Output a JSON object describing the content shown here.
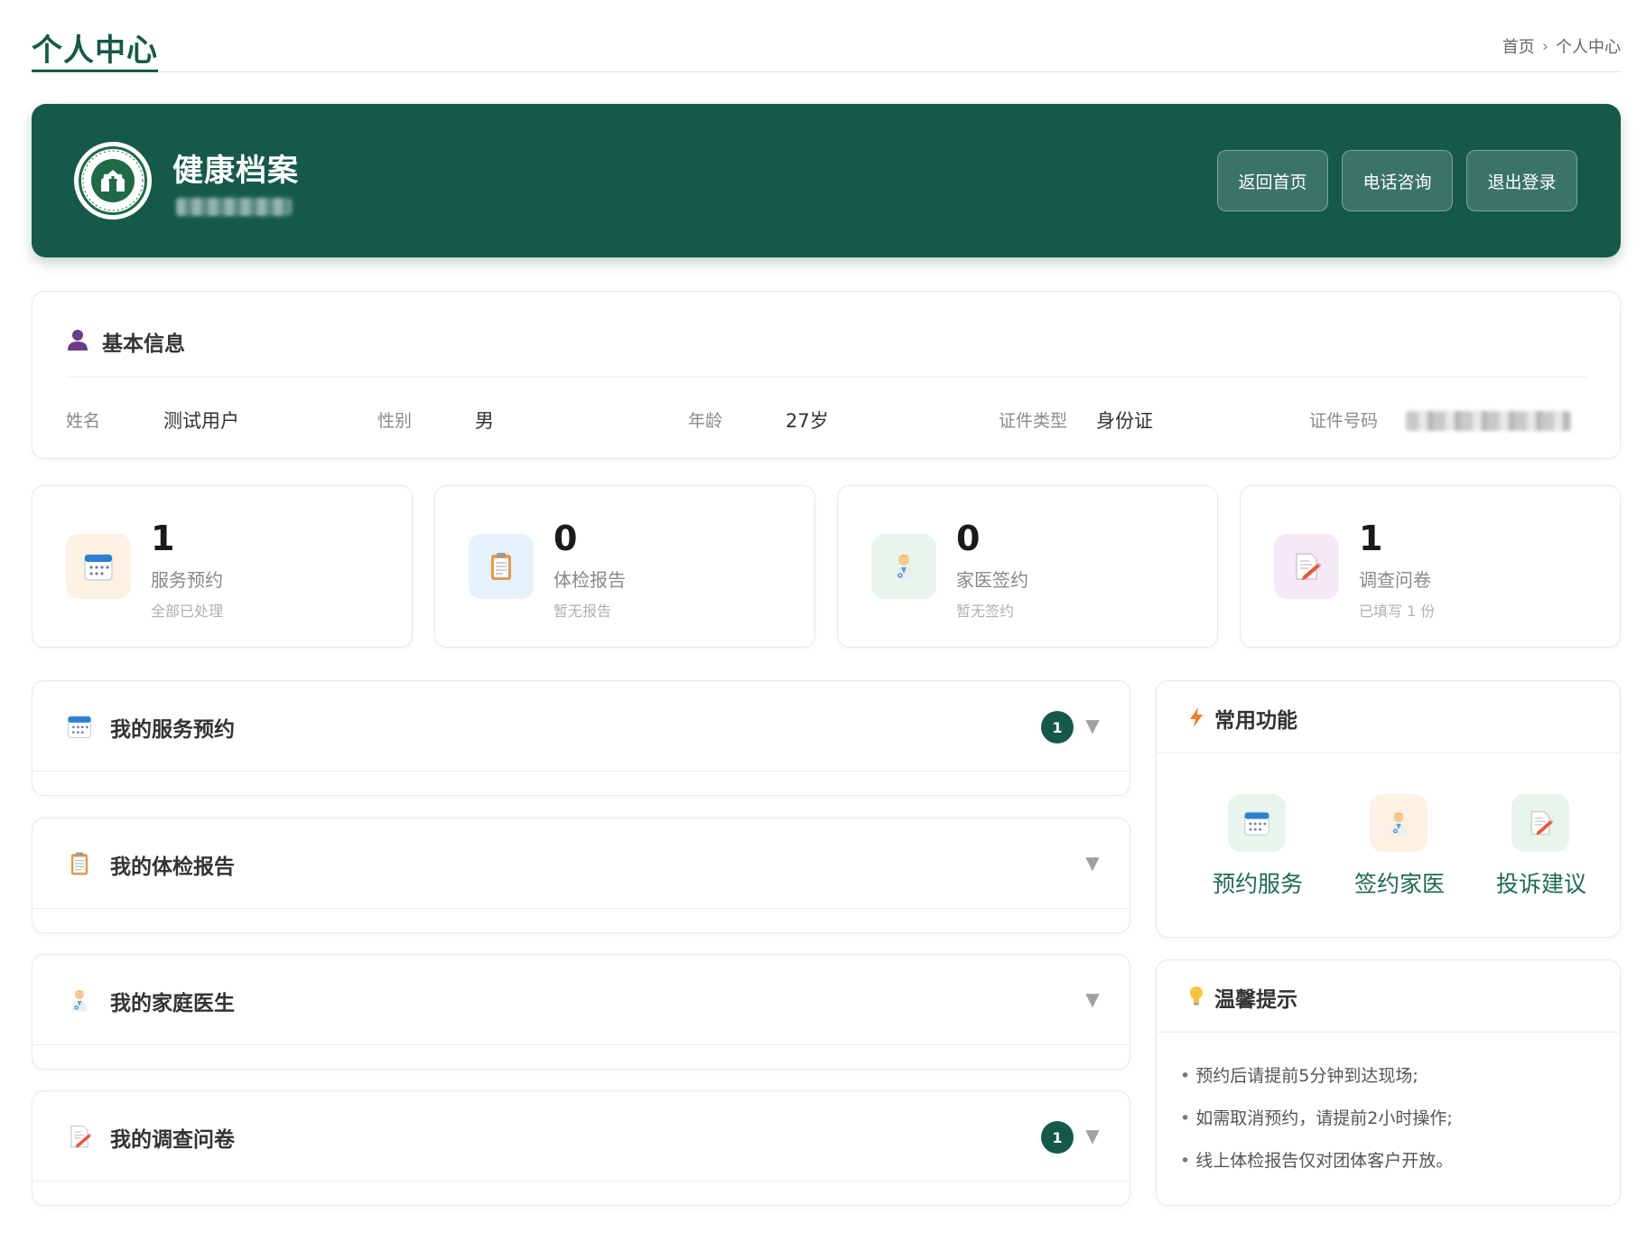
{
  "page": {
    "title": "个人中心",
    "breadcrumb": [
      "首页",
      "个人中心"
    ],
    "breadcrumb_separator": "›"
  },
  "banner": {
    "title": "健康档案",
    "logo_icon": "community-health-center-logo-icon",
    "buttons": [
      "返回首页",
      "电话咨询",
      "退出登录"
    ],
    "background": "#155a48"
  },
  "basic_info": {
    "title": "基本信息",
    "icon": "user-icon",
    "fields": [
      {
        "label": "姓名",
        "value": "测试用户"
      },
      {
        "label": "性别",
        "value": "男"
      },
      {
        "label": "年龄",
        "value": "27岁"
      },
      {
        "label": "证件类型",
        "value": "身份证"
      },
      {
        "label": "证件号码",
        "value": ""
      }
    ]
  },
  "stats": [
    {
      "value": "1",
      "label": "服务预约",
      "note": "全部已处理",
      "icon": "calendar-icon",
      "bg": "#fdf1e4"
    },
    {
      "value": "0",
      "label": "体检报告",
      "note": "暂无报告",
      "icon": "clipboard-icon",
      "bg": "#e5f2fb"
    },
    {
      "value": "0",
      "label": "家医签约",
      "note": "暂无签约",
      "icon": "doctor-icon",
      "bg": "#e8f5ec"
    },
    {
      "value": "1",
      "label": "调查问卷",
      "note": "已填写 1 份",
      "icon": "memo-pencil-icon",
      "bg": "#f6e9f6"
    }
  ],
  "sections": [
    {
      "title": "我的服务预约",
      "icon": "calendar-icon",
      "badge": "1"
    },
    {
      "title": "我的体检报告",
      "icon": "clipboard-icon",
      "badge": null
    },
    {
      "title": "我的家庭医生",
      "icon": "doctor-icon",
      "badge": null
    },
    {
      "title": "我的调查问卷",
      "icon": "memo-pencil-icon",
      "badge": "1"
    }
  ],
  "quick_functions": {
    "title": "常用功能",
    "icon": "lightning-icon",
    "items": [
      {
        "label": "预约服务",
        "icon": "calendar-icon",
        "bg": "#e8f5ec"
      },
      {
        "label": "签约家医",
        "icon": "doctor-icon",
        "bg": "#fdf1e4"
      },
      {
        "label": "投诉建议",
        "icon": "memo-pencil-icon",
        "bg": "#e8f5ec"
      }
    ]
  },
  "tips": {
    "title": "温馨提示",
    "icon": "lightbulb-icon",
    "items": [
      "预约后请提前5分钟到达现场;",
      "如需取消预约，请提前2小时操作;",
      "线上体检报告仅对团体客户开放。"
    ]
  },
  "colors": {
    "primary": "#155a48",
    "accent_text": "#1d6b55",
    "muted": "#888888"
  }
}
